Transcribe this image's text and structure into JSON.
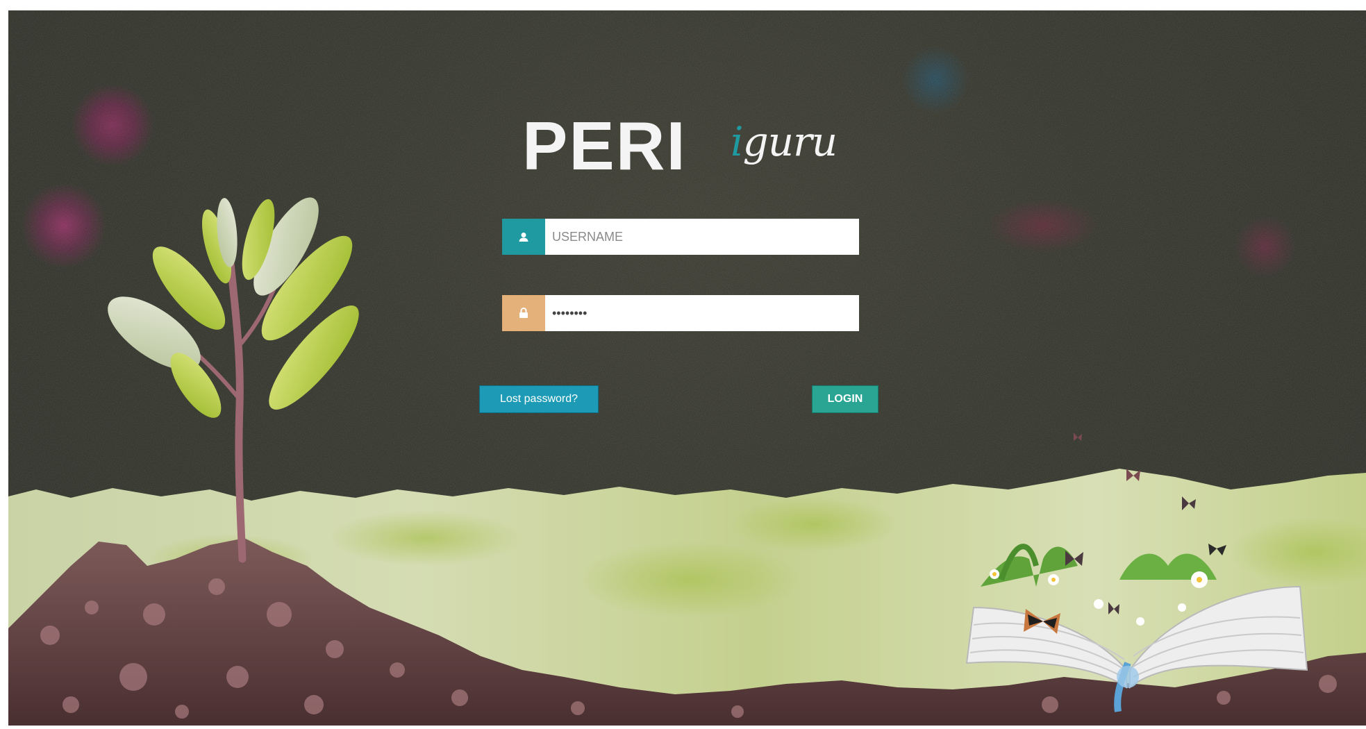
{
  "logo": {
    "brand_primary": "PERI",
    "brand_secondary_i": "i",
    "brand_secondary_rest": "guru"
  },
  "form": {
    "username": {
      "placeholder": "USERNAME",
      "value": "",
      "icon": "user-icon"
    },
    "password": {
      "placeholder": "",
      "value": "••••••••",
      "icon": "lock-icon"
    },
    "lost_password_label": "Lost password?",
    "login_label": "LOGIN"
  },
  "colors": {
    "teal": "#1f9aa0",
    "login_button": "#2aa593",
    "lost_button": "#1d9bb6",
    "password_icon_bg": "#e5b17a",
    "background": "#2f3129"
  }
}
